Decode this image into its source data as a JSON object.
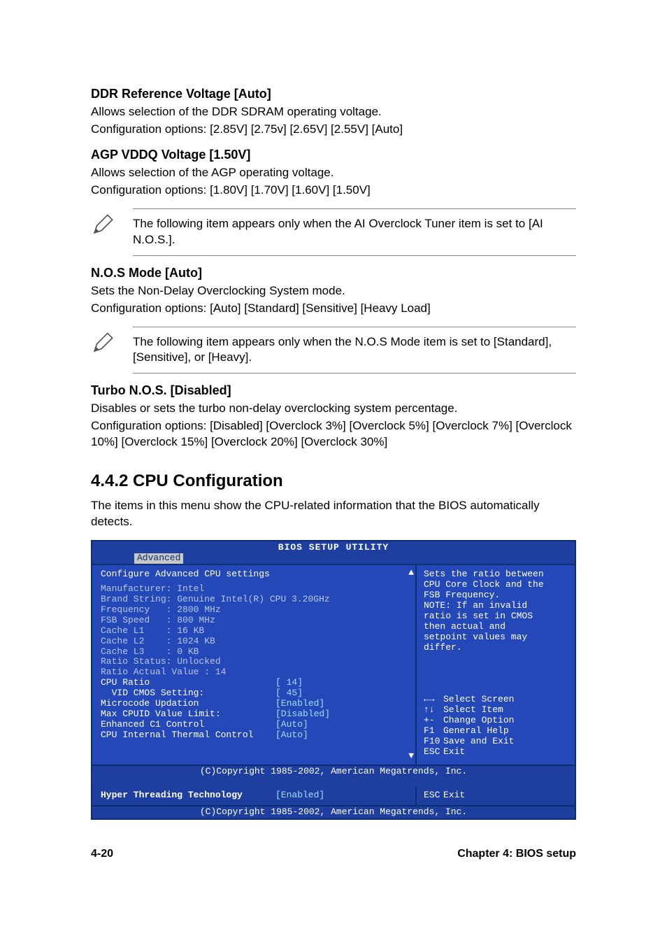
{
  "sections": {
    "ddr": {
      "title": "DDR Reference Voltage [Auto]",
      "line1": "Allows selection of the DDR SDRAM operating voltage.",
      "line2": "Configuration options: [2.85V] [2.75v] [2.65V] [2.55V] [Auto]"
    },
    "agp": {
      "title": "AGP VDDQ Voltage [1.50V]",
      "line1": "Allows selection of the AGP operating voltage.",
      "line2": "Configuration options: [1.80V] [1.70V] [1.60V] [1.50V]"
    },
    "note1": "The following item appears only when the AI Overclock Tuner item is set to [AI N.O.S.].",
    "nos": {
      "title": "N.O.S Mode [Auto]",
      "line1": "Sets the Non-Delay Overclocking System mode.",
      "line2": "Configuration options: [Auto] [Standard] [Sensitive] [Heavy Load]"
    },
    "note2": "The following item appears only when the N.O.S Mode item is set to [Standard], [Sensitive], or [Heavy].",
    "turbo": {
      "title": "Turbo N.O.S. [Disabled]",
      "line1": "Disables or sets the turbo non-delay overclocking system percentage.",
      "line2": "Configuration options: [Disabled] [Overclock 3%] [Overclock 5%] [Overclock 7%] [Overclock 10%] [Overclock 15%] [Overclock 20%] [Overclock 30%]"
    },
    "cpuconf": {
      "heading": "4.4.2   CPU Configuration",
      "intro": "The items in this menu show the CPU-related information that the BIOS automatically detects."
    }
  },
  "bios": {
    "title": "BIOS SETUP UTILITY",
    "tab": "Advanced",
    "left": {
      "header": "Configure Advanced CPU settings",
      "info": [
        "Manufacturer: Intel",
        "Brand String: Genuine Intel(R) CPU 3.20GHz",
        "Frequency   : 2800 MHz",
        "FSB Speed   : 800 MHz",
        "",
        "Cache L1    : 16 KB",
        "Cache L2    : 1024 KB",
        "Cache L3    : 0 KB",
        "",
        "Ratio Status: Unlocked",
        "Ratio Actual Value : 14"
      ],
      "items": [
        {
          "label": "CPU Ratio",
          "value": "[ 14]"
        },
        {
          "label": "  VID CMOS Setting:",
          "value": "[ 45]"
        },
        {
          "label": "Microcode Updation",
          "value": "[Enabled]"
        },
        {
          "label": "Max CPUID Value Limit:",
          "value": "[Disabled]"
        },
        {
          "label": "Enhanced C1 Control",
          "value": "[Auto]"
        },
        {
          "label": "CPU Internal Thermal Control",
          "value": "[Auto]"
        }
      ]
    },
    "right": {
      "hint1": "Sets the ratio between",
      "hint2": "CPU Core Clock and the",
      "hint3": "FSB Frequency.",
      "hint4": "NOTE: If an invalid",
      "hint5": "ratio is set in CMOS",
      "hint6": "then actual and",
      "hint7": "setpoint values may",
      "hint8": "differ.",
      "keys": [
        {
          "k": "←→",
          "t": "Select Screen"
        },
        {
          "k": "↑↓",
          "t": "Select Item"
        },
        {
          "k": "+-",
          "t": "Change Option"
        },
        {
          "k": "F1",
          "t": "General Help"
        },
        {
          "k": "F10",
          "t": "Save and Exit"
        },
        {
          "k": "ESC",
          "t": "Exit"
        }
      ]
    },
    "copyright": "(C)Copyright 1985-2002, American Megatrends, Inc.",
    "lower": {
      "label": "Hyper Threading Technology",
      "value": "[Enabled]",
      "right_k": "ESC",
      "right_t": "Exit"
    }
  },
  "footer": {
    "left": "4-20",
    "right": "Chapter 4: BIOS setup"
  }
}
